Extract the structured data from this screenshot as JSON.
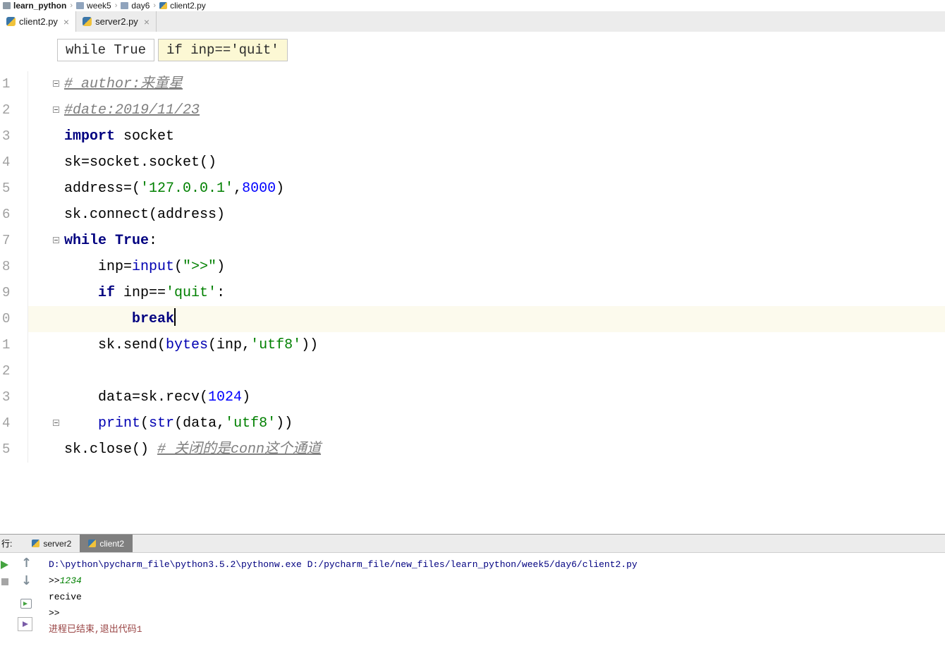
{
  "nav_breadcrumbs": {
    "separator": "›",
    "items": [
      {
        "label": "learn_python",
        "icon": "project-folder-icon",
        "bold": true
      },
      {
        "label": "week5",
        "icon": "folder-icon",
        "bold": false
      },
      {
        "label": "day6",
        "icon": "folder-icon",
        "bold": false
      },
      {
        "label": "client2.py",
        "icon": "python-file-icon",
        "bold": false
      }
    ]
  },
  "editor_tabs": [
    {
      "label": "client2.py",
      "active": true
    },
    {
      "label": "server2.py",
      "active": false
    }
  ],
  "context_hints": [
    {
      "text": "while True",
      "highlighted": false
    },
    {
      "text": "if inp=='quit'",
      "highlighted": true
    }
  ],
  "editor": {
    "lines": [
      {
        "gutter": "1",
        "fold": true,
        "current": false,
        "cursor": false,
        "tokens": [
          {
            "t": "# author:来童星",
            "c": "comment"
          }
        ]
      },
      {
        "gutter": "2",
        "fold": true,
        "current": false,
        "cursor": false,
        "tokens": [
          {
            "t": "#date:2019/11/23",
            "c": "comment"
          }
        ]
      },
      {
        "gutter": "3",
        "fold": false,
        "current": false,
        "cursor": false,
        "tokens": [
          {
            "t": "import",
            "c": "kw"
          },
          {
            "t": " socket",
            "c": "plain"
          }
        ]
      },
      {
        "gutter": "4",
        "fold": false,
        "current": false,
        "cursor": false,
        "tokens": [
          {
            "t": "sk=socket.socket()",
            "c": "plain"
          }
        ]
      },
      {
        "gutter": "5",
        "fold": false,
        "current": false,
        "cursor": false,
        "tokens": [
          {
            "t": "address=(",
            "c": "plain"
          },
          {
            "t": "'127.0.0.1'",
            "c": "str"
          },
          {
            "t": ",",
            "c": "plain"
          },
          {
            "t": "8000",
            "c": "num"
          },
          {
            "t": ")",
            "c": "plain"
          }
        ]
      },
      {
        "gutter": "6",
        "fold": false,
        "current": false,
        "cursor": false,
        "tokens": [
          {
            "t": "sk.connect(address)",
            "c": "plain"
          }
        ]
      },
      {
        "gutter": "7",
        "fold": true,
        "current": false,
        "cursor": false,
        "tokens": [
          {
            "t": "while",
            "c": "kw"
          },
          {
            "t": " ",
            "c": "plain"
          },
          {
            "t": "True",
            "c": "kw"
          },
          {
            "t": ":",
            "c": "plain"
          }
        ]
      },
      {
        "gutter": "8",
        "fold": false,
        "current": false,
        "cursor": false,
        "tokens": [
          {
            "t": "    inp=",
            "c": "plain"
          },
          {
            "t": "input",
            "c": "builtin"
          },
          {
            "t": "(",
            "c": "plain"
          },
          {
            "t": "\">>\"",
            "c": "str"
          },
          {
            "t": ")",
            "c": "plain"
          }
        ]
      },
      {
        "gutter": "9",
        "fold": false,
        "current": false,
        "cursor": false,
        "tokens": [
          {
            "t": "    ",
            "c": "plain"
          },
          {
            "t": "if",
            "c": "kw"
          },
          {
            "t": " inp==",
            "c": "plain"
          },
          {
            "t": "'quit'",
            "c": "str"
          },
          {
            "t": ":",
            "c": "plain"
          }
        ]
      },
      {
        "gutter": "0",
        "fold": false,
        "current": true,
        "cursor": true,
        "tokens": [
          {
            "t": "        ",
            "c": "plain"
          },
          {
            "t": "break",
            "c": "kw"
          }
        ]
      },
      {
        "gutter": "1",
        "fold": false,
        "current": false,
        "cursor": false,
        "tokens": [
          {
            "t": "    sk.send(",
            "c": "plain"
          },
          {
            "t": "bytes",
            "c": "builtin"
          },
          {
            "t": "(inp,",
            "c": "plain"
          },
          {
            "t": "'utf8'",
            "c": "str"
          },
          {
            "t": "))",
            "c": "plain"
          }
        ]
      },
      {
        "gutter": "2",
        "fold": false,
        "current": false,
        "cursor": false,
        "tokens": []
      },
      {
        "gutter": "3",
        "fold": false,
        "current": false,
        "cursor": false,
        "tokens": [
          {
            "t": "    data=sk.recv(",
            "c": "plain"
          },
          {
            "t": "1024",
            "c": "num"
          },
          {
            "t": ")",
            "c": "plain"
          }
        ]
      },
      {
        "gutter": "4",
        "fold": true,
        "current": false,
        "cursor": false,
        "tokens": [
          {
            "t": "    ",
            "c": "plain"
          },
          {
            "t": "print",
            "c": "builtin"
          },
          {
            "t": "(",
            "c": "plain"
          },
          {
            "t": "str",
            "c": "builtin"
          },
          {
            "t": "(data,",
            "c": "plain"
          },
          {
            "t": "'utf8'",
            "c": "str"
          },
          {
            "t": "))",
            "c": "plain"
          }
        ]
      },
      {
        "gutter": "5",
        "fold": false,
        "current": false,
        "cursor": false,
        "tokens": [
          {
            "t": "sk.close() ",
            "c": "plain"
          },
          {
            "t": "# 关闭的是conn这个通道",
            "c": "comment"
          }
        ]
      }
    ]
  },
  "run_panel": {
    "title": "行:",
    "tabs": [
      {
        "label": "server2",
        "active": false
      },
      {
        "label": "client2",
        "active": true
      }
    ],
    "toolbar_icons": [
      "rerun",
      "stop",
      "arrow-up",
      "arrow-down",
      "console",
      "scroll-to-end"
    ],
    "console": [
      {
        "tokens": [
          {
            "t": "D:\\python\\pycharm_file\\python3.5.2\\pythonw.exe D:/pycharm_file/new_files/learn_python/week5/day6/client2.py",
            "c": "path"
          }
        ]
      },
      {
        "tokens": [
          {
            "t": ">>",
            "c": "out"
          },
          {
            "t": "1234",
            "c": "user"
          }
        ]
      },
      {
        "tokens": [
          {
            "t": "recive",
            "c": "out"
          }
        ]
      },
      {
        "tokens": [
          {
            "t": ">>",
            "c": "out"
          }
        ]
      },
      {
        "tokens": [
          {
            "t": "进程已结束,退出代码1",
            "c": "exit"
          }
        ]
      }
    ]
  },
  "colors": {
    "keyword": "#000080",
    "string": "#008000",
    "number": "#0000ff",
    "builtin": "#0000b2",
    "comment": "#808080",
    "current_line_bg": "#fcfaed",
    "hint_highlight_bg": "#fcf8d4",
    "console_path": "#000080",
    "console_input": "#008000",
    "console_exit": "#994444",
    "run_active_tab_bg": "#7f7f7f"
  }
}
